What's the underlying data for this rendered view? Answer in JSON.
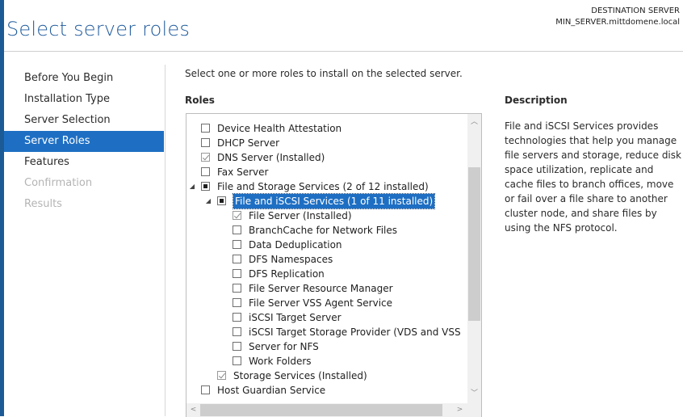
{
  "page": {
    "title": "Select server roles"
  },
  "destination": {
    "label": "DESTINATION SERVER",
    "server": "MIN_SERVER.mittdomene.local"
  },
  "nav": {
    "items": [
      {
        "label": "Before You Begin",
        "state": "normal"
      },
      {
        "label": "Installation Type",
        "state": "normal"
      },
      {
        "label": "Server Selection",
        "state": "normal"
      },
      {
        "label": "Server Roles",
        "state": "active"
      },
      {
        "label": "Features",
        "state": "normal"
      },
      {
        "label": "Confirmation",
        "state": "disabled"
      },
      {
        "label": "Results",
        "state": "disabled"
      }
    ]
  },
  "main": {
    "instruction": "Select one or more roles to install on the selected server.",
    "roles_label": "Roles",
    "description_label": "Description",
    "description_text": "File and iSCSI Services provides technologies that help you manage file servers and storage, reduce disk space utilization, replicate and cache files to branch offices, move or fail over a file share to another cluster node, and share files by using the NFS protocol."
  },
  "roles": [
    {
      "label": "Device Health Attestation",
      "level": 0,
      "check": "unchecked",
      "expander": "none"
    },
    {
      "label": "DHCP Server",
      "level": 0,
      "check": "unchecked",
      "expander": "none"
    },
    {
      "label": "DNS Server (Installed)",
      "level": 0,
      "check": "checked",
      "expander": "none"
    },
    {
      "label": "Fax Server",
      "level": 0,
      "check": "unchecked",
      "expander": "none"
    },
    {
      "label": "File and Storage Services (2 of 12 installed)",
      "level": 0,
      "check": "partial",
      "expander": "expanded"
    },
    {
      "label": "File and iSCSI Services (1 of 11 installed)",
      "level": 1,
      "check": "partial",
      "expander": "expanded",
      "selected": true
    },
    {
      "label": "File Server (Installed)",
      "level": 2,
      "check": "checked",
      "expander": "none"
    },
    {
      "label": "BranchCache for Network Files",
      "level": 2,
      "check": "unchecked",
      "expander": "none"
    },
    {
      "label": "Data Deduplication",
      "level": 2,
      "check": "unchecked",
      "expander": "none"
    },
    {
      "label": "DFS Namespaces",
      "level": 2,
      "check": "unchecked",
      "expander": "none"
    },
    {
      "label": "DFS Replication",
      "level": 2,
      "check": "unchecked",
      "expander": "none"
    },
    {
      "label": "File Server Resource Manager",
      "level": 2,
      "check": "unchecked",
      "expander": "none"
    },
    {
      "label": "File Server VSS Agent Service",
      "level": 2,
      "check": "unchecked",
      "expander": "none"
    },
    {
      "label": "iSCSI Target Server",
      "level": 2,
      "check": "unchecked",
      "expander": "none"
    },
    {
      "label": "iSCSI Target Storage Provider (VDS and VSS",
      "level": 2,
      "check": "unchecked",
      "expander": "none"
    },
    {
      "label": "Server for NFS",
      "level": 2,
      "check": "unchecked",
      "expander": "none"
    },
    {
      "label": "Work Folders",
      "level": 2,
      "check": "unchecked",
      "expander": "none"
    },
    {
      "label": "Storage Services (Installed)",
      "level": 1,
      "check": "checked",
      "expander": "none"
    },
    {
      "label": "Host Guardian Service",
      "level": 0,
      "check": "unchecked",
      "expander": "none"
    }
  ],
  "icons": {
    "expanded": "expanded-arrow-icon",
    "scroll_up": "scroll-up-icon",
    "scroll_down": "scroll-down-icon",
    "scroll_left": "scroll-left-icon",
    "scroll_right": "scroll-right-icon"
  },
  "colors": {
    "accent": "#1e6fc3",
    "title": "#1e5a9c",
    "disabled": "#b4b4b4"
  }
}
